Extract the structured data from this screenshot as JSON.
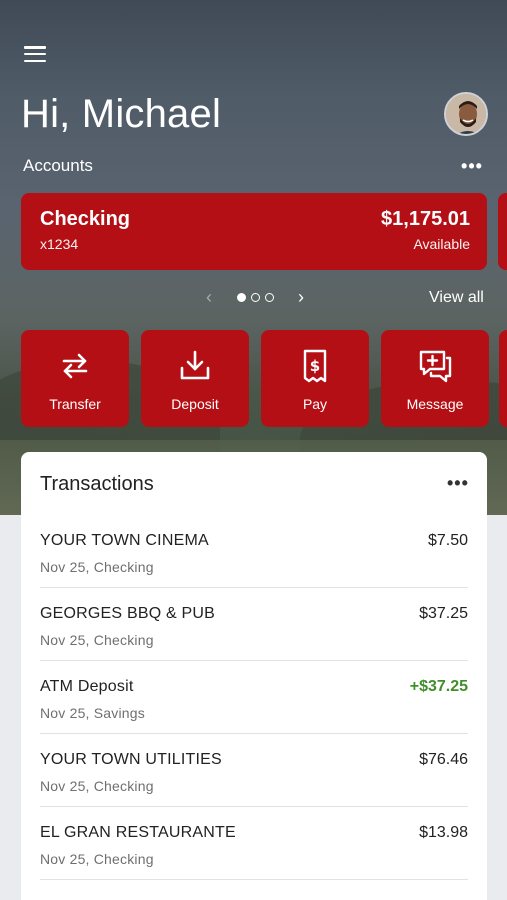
{
  "header": {
    "greeting": "Hi, Michael"
  },
  "accounts": {
    "label": "Accounts",
    "more_glyph": "•••",
    "cards": [
      {
        "name": "Checking",
        "number": "x1234",
        "balance": "$1,175.01",
        "balance_label": "Available"
      }
    ],
    "pager": {
      "total_pages": 3,
      "active_index": 0
    },
    "view_all_label": "View all"
  },
  "actions": [
    {
      "label": "Transfer",
      "icon": "transfer-icon"
    },
    {
      "label": "Deposit",
      "icon": "deposit-icon"
    },
    {
      "label": "Pay",
      "icon": "pay-bill-icon"
    },
    {
      "label": "Message",
      "icon": "message-icon"
    }
  ],
  "transactions": {
    "title": "Transactions",
    "more_glyph": "•••",
    "items": [
      {
        "merchant": "YOUR TOWN CINEMA",
        "meta": "Nov 25, Checking",
        "amount": "$7.50",
        "credit": false
      },
      {
        "merchant": "GEORGES BBQ & PUB",
        "meta": "Nov 25, Checking",
        "amount": "$37.25",
        "credit": false
      },
      {
        "merchant": "ATM Deposit",
        "meta": "Nov 25, Savings",
        "amount": "+$37.25",
        "credit": true
      },
      {
        "merchant": "YOUR TOWN UTILITIES",
        "meta": "Nov 25, Checking",
        "amount": "$76.46",
        "credit": false
      },
      {
        "merchant": "EL GRAN RESTAURANTE",
        "meta": "Nov 25, Checking",
        "amount": "$13.98",
        "credit": false
      }
    ]
  },
  "colors": {
    "brand_red": "#b50f16",
    "credit_green": "#3f8f2a"
  }
}
